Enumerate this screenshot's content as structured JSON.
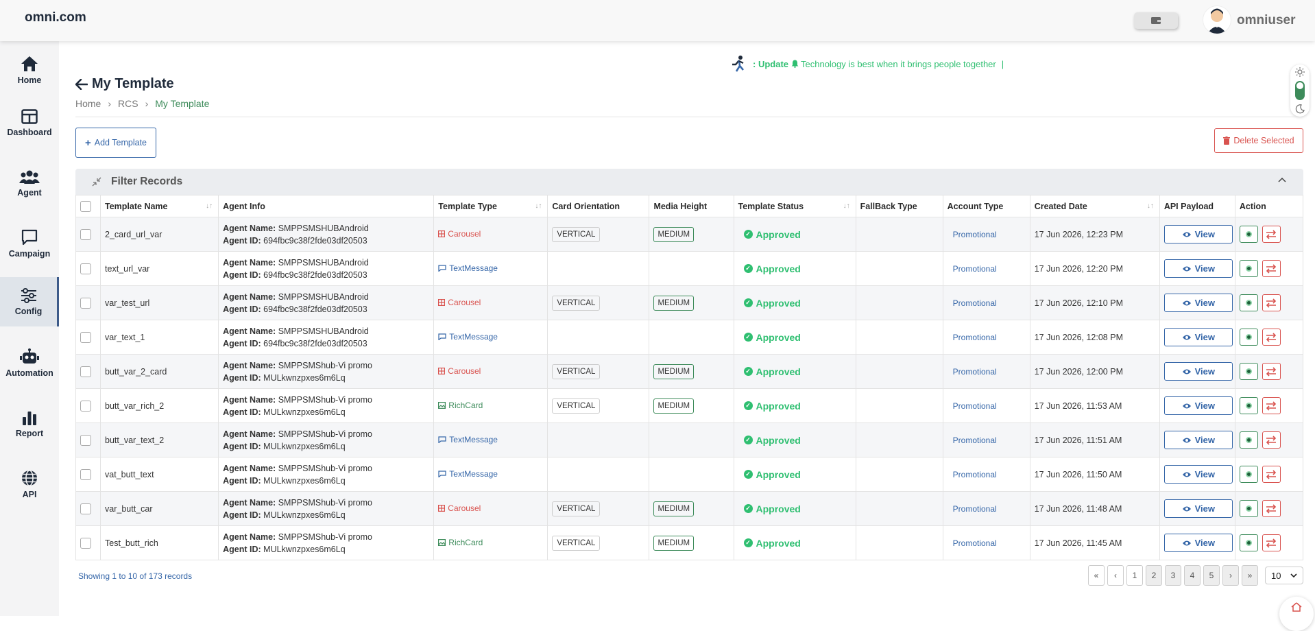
{
  "brand": "omni.com",
  "user": {
    "name": "omniuser"
  },
  "sidebar": {
    "items": [
      {
        "label": "Home",
        "icon": "home-icon"
      },
      {
        "label": "Dashboard",
        "icon": "dashboard-icon"
      },
      {
        "label": "Agent",
        "icon": "agent-icon"
      },
      {
        "label": "Campaign",
        "icon": "campaign-icon"
      },
      {
        "label": "Config",
        "icon": "config-icon",
        "active": true
      },
      {
        "label": "Automation",
        "icon": "automation-icon"
      },
      {
        "label": "Report",
        "icon": "report-icon"
      },
      {
        "label": "API",
        "icon": "api-icon"
      }
    ]
  },
  "ticker": {
    "prefix": ": Update",
    "message": "Technology is best when it brings people together",
    "caret": "|"
  },
  "page": {
    "title": "My Template"
  },
  "breadcrumb": {
    "items": [
      "Home",
      "RCS",
      "My Template"
    ]
  },
  "actions": {
    "add_label": "Add Template",
    "delete_label": "Delete Selected"
  },
  "filter": {
    "title": "Filter Records"
  },
  "table": {
    "headers": [
      "Template Name",
      "Agent Info",
      "Template Type",
      "Card Orientation",
      "Media Height",
      "Template Status",
      "FallBack Type",
      "Account Type",
      "Created Date",
      "API Payload",
      "Action"
    ],
    "agent_name_label": "Agent Name:",
    "agent_id_label": "Agent ID:",
    "view_label": "View",
    "rows": [
      {
        "name": "2_card_url_var",
        "agent_name": "SMPPSMSHUBAndroid",
        "agent_id": "694fbc9c38f2fde03df20503",
        "type": "Carousel",
        "type_kind": "carousel",
        "orientation": "VERTICAL",
        "media_height": "MEDIUM",
        "status": "Approved",
        "fallback": "",
        "account": "Promotional",
        "created": "17 Jun 2026, 12:23 PM"
      },
      {
        "name": "text_url_var",
        "agent_name": "SMPPSMSHUBAndroid",
        "agent_id": "694fbc9c38f2fde03df20503",
        "type": "TextMessage",
        "type_kind": "text",
        "orientation": "",
        "media_height": "",
        "status": "Approved",
        "fallback": "",
        "account": "Promotional",
        "created": "17 Jun 2026, 12:20 PM"
      },
      {
        "name": "var_test_url",
        "agent_name": "SMPPSMSHUBAndroid",
        "agent_id": "694fbc9c38f2fde03df20503",
        "type": "Carousel",
        "type_kind": "carousel",
        "orientation": "VERTICAL",
        "media_height": "MEDIUM",
        "status": "Approved",
        "fallback": "",
        "account": "Promotional",
        "created": "17 Jun 2026, 12:10 PM"
      },
      {
        "name": "var_text_1",
        "agent_name": "SMPPSMSHUBAndroid",
        "agent_id": "694fbc9c38f2fde03df20503",
        "type": "TextMessage",
        "type_kind": "text",
        "orientation": "",
        "media_height": "",
        "status": "Approved",
        "fallback": "",
        "account": "Promotional",
        "created": "17 Jun 2026, 12:08 PM"
      },
      {
        "name": "butt_var_2_card",
        "agent_name": "SMPPSMShub-Vi promo",
        "agent_id": "MULkwnzpxes6m6Lq",
        "type": "Carousel",
        "type_kind": "carousel",
        "orientation": "VERTICAL",
        "media_height": "MEDIUM",
        "status": "Approved",
        "fallback": "",
        "account": "Promotional",
        "created": "17 Jun 2026, 12:00 PM"
      },
      {
        "name": "butt_var_rich_2",
        "agent_name": "SMPPSMShub-Vi promo",
        "agent_id": "MULkwnzpxes6m6Lq",
        "type": "RichCard",
        "type_kind": "rich",
        "orientation": "VERTICAL",
        "media_height": "MEDIUM",
        "status": "Approved",
        "fallback": "",
        "account": "Promotional",
        "created": "17 Jun 2026, 11:53 AM"
      },
      {
        "name": "butt_var_text_2",
        "agent_name": "SMPPSMShub-Vi promo",
        "agent_id": "MULkwnzpxes6m6Lq",
        "type": "TextMessage",
        "type_kind": "text",
        "orientation": "",
        "media_height": "",
        "status": "Approved",
        "fallback": "",
        "account": "Promotional",
        "created": "17 Jun 2026, 11:51 AM"
      },
      {
        "name": "vat_butt_text",
        "agent_name": "SMPPSMShub-Vi promo",
        "agent_id": "MULkwnzpxes6m6Lq",
        "type": "TextMessage",
        "type_kind": "text",
        "orientation": "",
        "media_height": "",
        "status": "Approved",
        "fallback": "",
        "account": "Promotional",
        "created": "17 Jun 2026, 11:50 AM"
      },
      {
        "name": "var_butt_car",
        "agent_name": "SMPPSMShub-Vi promo",
        "agent_id": "MULkwnzpxes6m6Lq",
        "type": "Carousel",
        "type_kind": "carousel",
        "orientation": "VERTICAL",
        "media_height": "MEDIUM",
        "status": "Approved",
        "fallback": "",
        "account": "Promotional",
        "created": "17 Jun 2026, 11:48 AM"
      },
      {
        "name": "Test_butt_rich",
        "agent_name": "SMPPSMShub-Vi promo",
        "agent_id": "MULkwnzpxes6m6Lq",
        "type": "RichCard",
        "type_kind": "rich",
        "orientation": "VERTICAL",
        "media_height": "MEDIUM",
        "status": "Approved",
        "fallback": "",
        "account": "Promotional",
        "created": "17 Jun 2026, 11:45 AM"
      }
    ]
  },
  "footer": {
    "records_text": "Showing 1 to 10 of 173 records",
    "pager": {
      "first": "«",
      "prev": "‹",
      "pages": [
        "1",
        "2",
        "3",
        "4",
        "5"
      ],
      "next": "›",
      "last": "»"
    },
    "page_size": "10"
  },
  "colors": {
    "accent_blue": "#3566a8",
    "accent_green": "#3d8b5a",
    "status_green": "#2fbf71",
    "danger_red": "#d9534f"
  }
}
